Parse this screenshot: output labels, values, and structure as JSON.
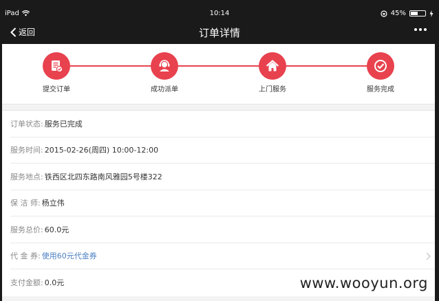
{
  "status_bar": {
    "device": "iPad",
    "time": "10:14",
    "battery": "45%"
  },
  "nav": {
    "back_label": "返回",
    "title": "订单详情",
    "back_icon": "chevron-left-icon",
    "more_icon": "more-dots-icon"
  },
  "steps": [
    {
      "label": "提交订单",
      "icon": "order-submit-icon"
    },
    {
      "label": "成功派单",
      "icon": "agent-headset-icon"
    },
    {
      "label": "上门服务",
      "icon": "home-icon"
    },
    {
      "label": "服务完成",
      "icon": "check-icon"
    }
  ],
  "progress_color": "#e8424e",
  "details": [
    {
      "key": "订单状态:",
      "value": "服务已完成"
    },
    {
      "key": "服务时间:",
      "value": "2015-02-26(周四) 10:00-12:00"
    },
    {
      "key": "服务地点:",
      "value": "铁西区北四东路南风雅园5号楼322"
    },
    {
      "key": "保 洁 师:",
      "value": "杨立伟"
    },
    {
      "key": "服务总价:",
      "value": "60.0元"
    },
    {
      "key": "代 金 券:",
      "value": "使用60元代金券"
    },
    {
      "key": "支付金额:",
      "value": "0.0元"
    }
  ],
  "watermark": "www.wooyun.org"
}
